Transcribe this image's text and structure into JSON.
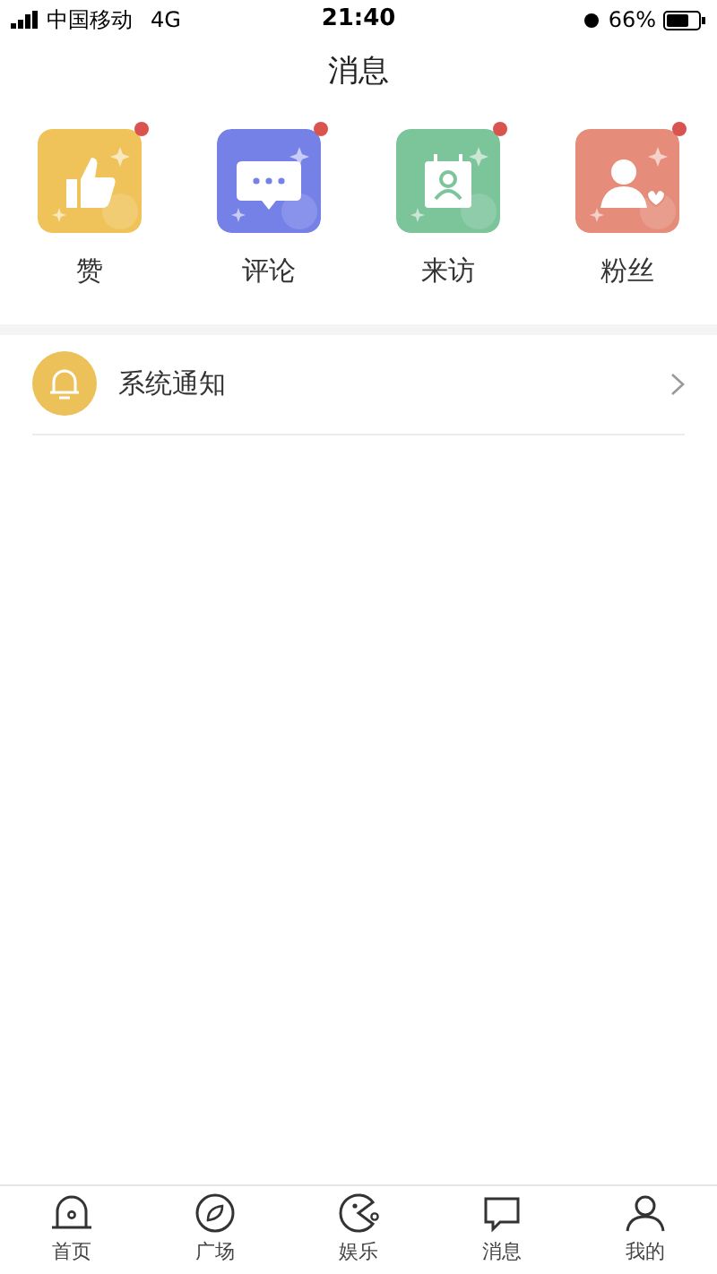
{
  "status_bar": {
    "carrier": "中国移动",
    "network": "4G",
    "time": "21:40",
    "battery": "66%"
  },
  "title": "消息",
  "categories": [
    {
      "label": "赞",
      "kind": "like",
      "color": "#f0c35a",
      "badge": true
    },
    {
      "label": "评论",
      "kind": "comment",
      "color": "#7681e8",
      "badge": true
    },
    {
      "label": "来访",
      "kind": "visitor",
      "color": "#7cc49a",
      "badge": true
    },
    {
      "label": "粉丝",
      "kind": "fans",
      "color": "#e58c7a",
      "badge": true
    }
  ],
  "notices": [
    {
      "label": "系统通知",
      "kind": "bell"
    }
  ],
  "tab_bar": [
    {
      "label": "首页",
      "kind": "home"
    },
    {
      "label": "广场",
      "kind": "compass"
    },
    {
      "label": "娱乐",
      "kind": "game"
    },
    {
      "label": "消息",
      "kind": "chat"
    },
    {
      "label": "我的",
      "kind": "user"
    }
  ]
}
